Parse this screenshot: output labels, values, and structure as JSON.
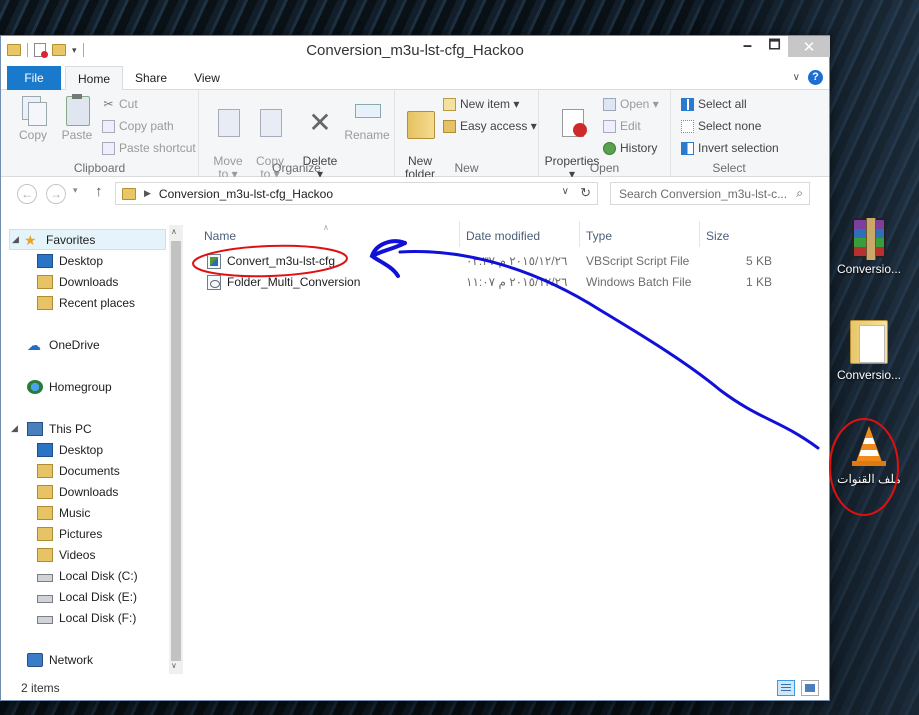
{
  "window": {
    "title": "Conversion_m3u-lst-cfg_Hackoo",
    "minimize": "🗕",
    "maximize": "🗖",
    "close": "✕"
  },
  "ribbon": {
    "tabs": [
      "File",
      "Home",
      "Share",
      "View"
    ],
    "groups": {
      "clipboard": {
        "label": "Clipboard",
        "copy": "Copy",
        "paste": "Paste",
        "cut": "Cut",
        "copy_path": "Copy path",
        "paste_shortcut": "Paste shortcut"
      },
      "organize": {
        "label": "Organize",
        "move_to": "Move\nto ▾",
        "copy_to": "Copy\nto ▾",
        "delete": "Delete\n▾",
        "rename": "Rename"
      },
      "new": {
        "label": "New",
        "new_folder": "New\nfolder",
        "new_item": "New item ▾",
        "easy_access": "Easy access ▾"
      },
      "open": {
        "label": "Open",
        "properties": "Properties\n▾",
        "open": "Open ▾",
        "edit": "Edit",
        "history": "History"
      },
      "select": {
        "label": "Select",
        "select_all": "Select all",
        "select_none": "Select none",
        "invert_selection": "Invert selection"
      }
    }
  },
  "address": {
    "path": "Conversion_m3u-lst-cfg_Hackoo",
    "search_placeholder": "Search Conversion_m3u-lst-c..."
  },
  "nav_pane": {
    "favorites": "Favorites",
    "fav_items": [
      "Desktop",
      "Downloads",
      "Recent places"
    ],
    "onedrive": "OneDrive",
    "homegroup": "Homegroup",
    "this_pc": "This PC",
    "pc_items": [
      "Desktop",
      "Documents",
      "Downloads",
      "Music",
      "Pictures",
      "Videos",
      "Local Disk (C:)",
      "Local Disk (E:)",
      "Local Disk (F:)"
    ],
    "network": "Network"
  },
  "columns": {
    "name": "Name",
    "date": "Date modified",
    "type": "Type",
    "size": "Size"
  },
  "files": [
    {
      "name": "Convert_m3u-lst-cfg",
      "date": "٢٠١٥/١٢/٢٦ م ٠٣:٣٧",
      "type": "VBScript Script File",
      "size": "5 KB"
    },
    {
      "name": "Folder_Multi_Conversion",
      "date": "٢٠١٥/١٢/٢٦ م ١١:٠٧",
      "type": "Windows Batch File",
      "size": "1 KB"
    }
  ],
  "status": {
    "item_count": "2 items"
  },
  "desktop_icons": [
    {
      "label": "Conversio..."
    },
    {
      "label": "Conversio..."
    },
    {
      "label": "ملف القنوات"
    }
  ],
  "colors": {
    "accent": "#1979ca",
    "annotation_red": "#e01010",
    "annotation_blue": "#1010d8"
  }
}
